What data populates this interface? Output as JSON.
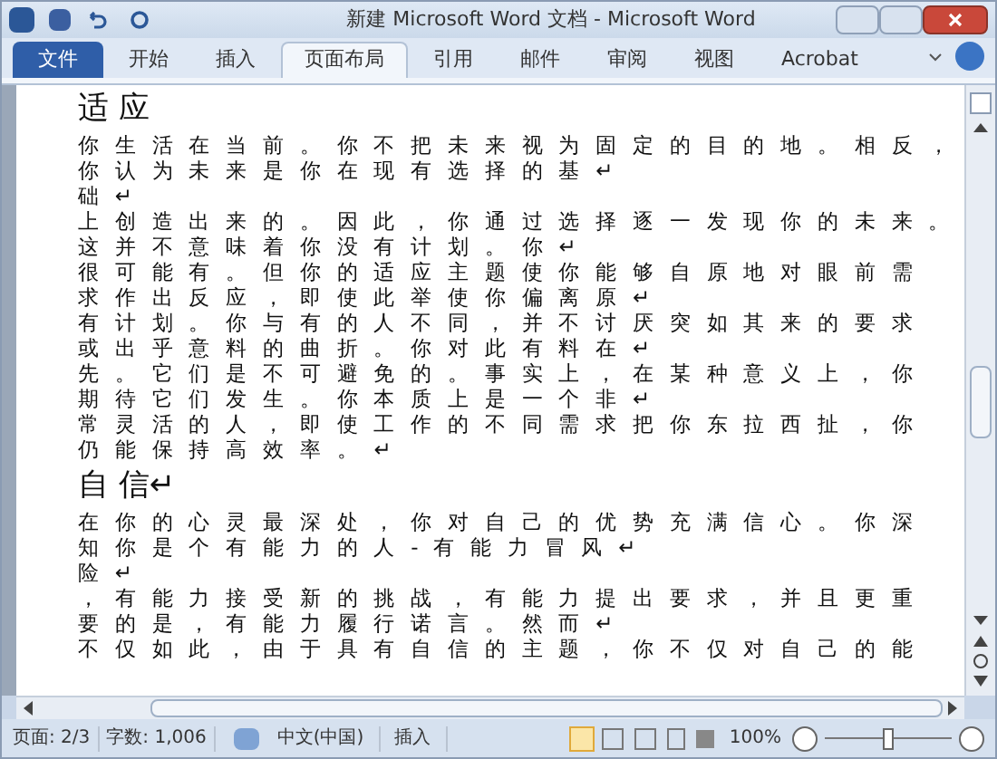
{
  "window": {
    "title": "新建 Microsoft Word 文档  -  Microsoft Word"
  },
  "file_tab": {
    "label": "文件"
  },
  "tabs": [
    {
      "label": "开始",
      "selected": false
    },
    {
      "label": "插入",
      "selected": false
    },
    {
      "label": "页面布局",
      "selected": true
    },
    {
      "label": "引用",
      "selected": false
    },
    {
      "label": "邮件",
      "selected": false
    },
    {
      "label": "审阅",
      "selected": false
    },
    {
      "label": "视图",
      "selected": false
    },
    {
      "label": "Acrobat",
      "selected": false
    }
  ],
  "document": [
    {
      "kind": "heading",
      "text": "适 应"
    },
    {
      "kind": "line",
      "text": "你生活在当前。你不把未来视为固定的目的地。相反，"
    },
    {
      "kind": "line",
      "text": "你认为未来是你在现有选择的基↵"
    },
    {
      "kind": "line",
      "text": "础↵"
    },
    {
      "kind": "line",
      "text": "上创造出来的。因此，你通过选择逐一发现你的未来。"
    },
    {
      "kind": "line",
      "text": "这并不意味着你没有计划。你↵"
    },
    {
      "kind": "line",
      "text": "很可能有。但你的适应主题使你能够自原地对眼前需"
    },
    {
      "kind": "line",
      "text": "求作出反应，即使此举使你偏离原↵"
    },
    {
      "kind": "line",
      "text": "有计划。你与有的人不同，并不讨厌突如其来的要求"
    },
    {
      "kind": "line",
      "text": "或出乎意料的曲折。你对此有料在↵"
    },
    {
      "kind": "line",
      "text": "先。它们是不可避免的。事实上，在某种意义上，你"
    },
    {
      "kind": "line",
      "text": "期待它们发生。你本质上是一个非↵"
    },
    {
      "kind": "line",
      "text": "常灵活的人，即使工作的不同需求把你东拉西扯，你"
    },
    {
      "kind": "line",
      "text": "仍能保持高效率。↵"
    },
    {
      "kind": "heading",
      "text": "自 信↵"
    },
    {
      "kind": "line",
      "text": "在你的心灵最深处，你对自己的优势充满信心。你深"
    },
    {
      "kind": "line",
      "text": "知你是个有能力的人-有能力冒风↵"
    },
    {
      "kind": "line",
      "text": "险↵"
    },
    {
      "kind": "line",
      "text": "，有能力接受新的挑战，有能力提出要求，并且更重"
    },
    {
      "kind": "line",
      "text": "要的是，有能力履行诺言。然而↵"
    },
    {
      "kind": "line",
      "text": "不仅如此，由于具有自信的主题，你不仅对自己的能"
    }
  ],
  "status_bar": {
    "page": "页面: 2/3",
    "words": "字数: 1,006",
    "language": "中文(中国)",
    "mode": "插入",
    "zoom": "100%",
    "zoom_slider": {
      "level": 0.5
    }
  }
}
